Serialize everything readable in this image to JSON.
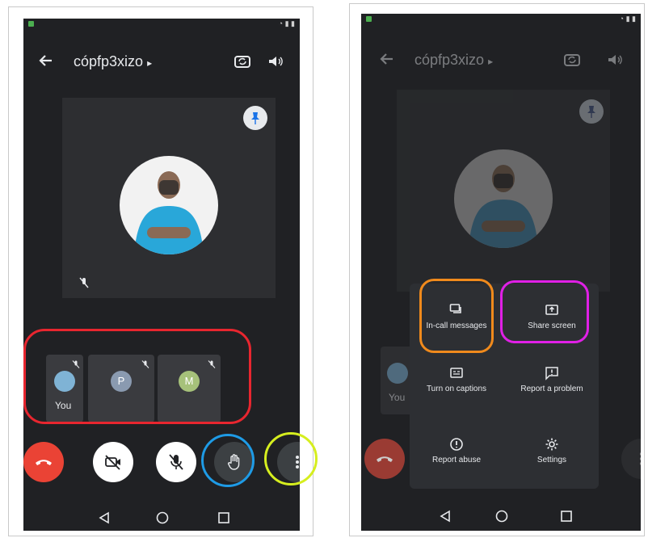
{
  "colors": {
    "screen_bg": "#202124",
    "tile_bg": "#2d2e31",
    "end_call_red": "#ea4335",
    "highlight_red": "#e8262f",
    "highlight_blue": "#1e9be6",
    "highlight_yellow": "#d6ee1f",
    "highlight_orange": "#f08a1c",
    "highlight_magenta": "#e020e6"
  },
  "left_screen": {
    "header": {
      "back_icon": "arrow-left-icon",
      "meeting_code": "cópfp3xizo",
      "chevron": "▸",
      "switch_camera_icon": "camera-switch-icon",
      "audio_icon": "speaker-icon"
    },
    "participants": [
      {
        "initial": "",
        "label": "You",
        "avatar_color": "#7fb3d5"
      },
      {
        "initial": "P",
        "label": "",
        "avatar_color": "#8a9ab0"
      },
      {
        "initial": "M",
        "label": "",
        "avatar_color": "#a6c17a"
      }
    ],
    "controls": [
      "end-call-icon",
      "camera-off-icon",
      "mic-off-icon",
      "raise-hand-icon",
      "more-vert-icon"
    ]
  },
  "right_screen": {
    "header": {
      "meeting_code": "cópfp3xizo",
      "chevron": "▸"
    },
    "menu": {
      "in_call_messages": "In-call messages",
      "share_screen": "Share screen",
      "turn_on_captions": "Turn on captions",
      "report_problem": "Report a problem",
      "report_abuse": "Report abuse",
      "settings": "Settings"
    },
    "partial_you_label": "You"
  },
  "nav": [
    "back-triangle-icon",
    "home-circle-icon",
    "recents-square-icon"
  ]
}
